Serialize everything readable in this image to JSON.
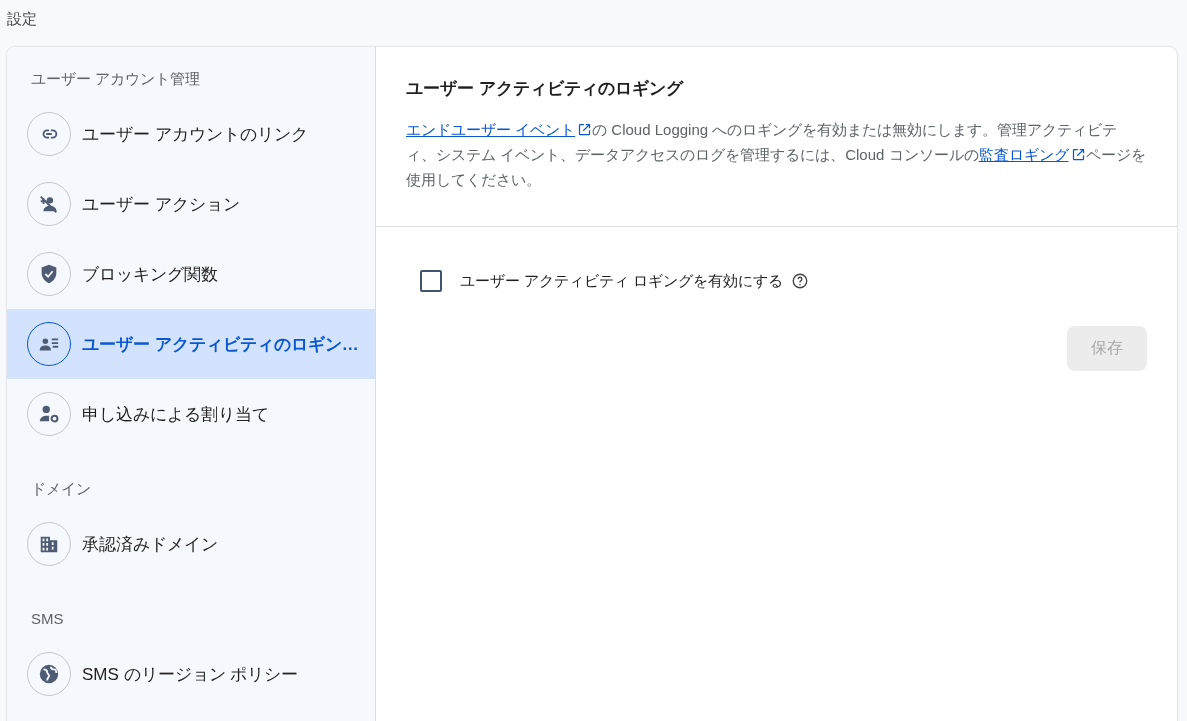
{
  "page_title": "設定",
  "sidebar": {
    "groups": [
      {
        "heading": "ユーザー アカウント管理",
        "items": [
          {
            "label": "ユーザー アカウントのリンク",
            "selected": false
          },
          {
            "label": "ユーザー アクション",
            "selected": false
          },
          {
            "label": "ブロッキング関数",
            "selected": false
          },
          {
            "label": "ユーザー アクティビティのロギン…",
            "selected": true
          },
          {
            "label": "申し込みによる割り当て",
            "selected": false
          }
        ]
      },
      {
        "heading": "ドメイン",
        "items": [
          {
            "label": "承認済みドメイン",
            "selected": false
          }
        ]
      },
      {
        "heading": "SMS",
        "items": [
          {
            "label": "SMS のリージョン ポリシー",
            "selected": false
          }
        ]
      }
    ]
  },
  "content": {
    "title": "ユーザー アクティビティのロギング",
    "description": [
      {
        "kind": "link",
        "text": "エンドユーザー イベント"
      },
      {
        "kind": "text",
        "text": "の Cloud Logging へのロギングを有効または無効にします。管理アクティビティ、システム イベント、データアクセスのログを管理するには、Cloud コンソールの"
      },
      {
        "kind": "link",
        "text": "監査ロギング"
      },
      {
        "kind": "text",
        "text": "ページを使用してください。"
      }
    ],
    "checkbox": {
      "label": "ユーザー アクティビティ ロギングを有効にする",
      "checked": false
    },
    "save_button": {
      "label": "保存",
      "disabled": true
    }
  }
}
